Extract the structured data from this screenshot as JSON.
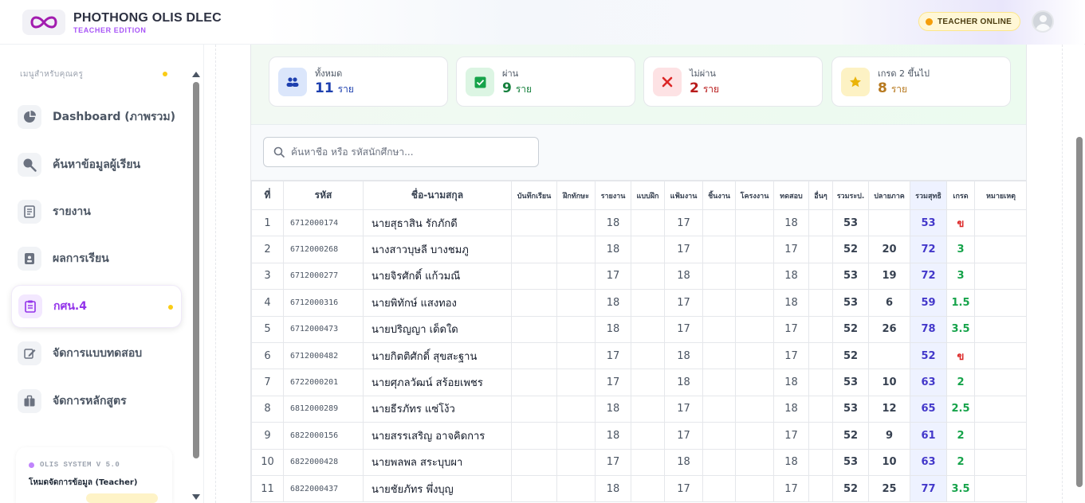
{
  "brand": {
    "title": "PHOTHONG OLIS DLEC",
    "subtitle": "TEACHER EDITION"
  },
  "header": {
    "status_badge": "TEACHER ONLINE"
  },
  "sidebar": {
    "heading": "เมนูสำหรับคุณครู",
    "items": [
      {
        "label": "Dashboard (ภาพรวม)",
        "icon": "pie-chart-icon"
      },
      {
        "label": "ค้นหาข้อมูลผู้เรียน",
        "icon": "search-icon"
      },
      {
        "label": "รายงาน",
        "icon": "report-icon"
      },
      {
        "label": "ผลการเรียน",
        "icon": "id-card-icon"
      },
      {
        "label": "กศน.4",
        "icon": "clipboard-icon",
        "active": true
      },
      {
        "label": "จัดการแบบทดสอบ",
        "icon": "edit-icon"
      },
      {
        "label": "จัดการหลักสูตร",
        "icon": "briefcase-icon"
      }
    ],
    "system": {
      "title": "OLIS SYSTEM V 5.0",
      "mode": "โหมดจัดการข้อมูล (Teacher)"
    }
  },
  "stats": [
    {
      "label": "ทั้งหมด",
      "value": "11",
      "unit": "ราย",
      "color": "#1e40af",
      "icon_bg": "#dbe6fb",
      "icon": "users-icon"
    },
    {
      "label": "ผ่าน",
      "value": "9",
      "unit": "ราย",
      "color": "#15803d",
      "icon_bg": "#dcf5e3",
      "icon": "check-square-icon"
    },
    {
      "label": "ไม่ผ่าน",
      "value": "2",
      "unit": "ราย",
      "color": "#b91c1c",
      "icon_bg": "#fde2e4",
      "icon": "x-icon"
    },
    {
      "label": "เกรด 2 ขึ้นไป",
      "value": "8",
      "unit": "ราย",
      "color": "#b7791f",
      "icon_bg": "#fdf2c4",
      "icon": "star-icon"
    }
  ],
  "search": {
    "placeholder": "ค้นหาชื่อ หรือ รหัสนักศึกษา..."
  },
  "table": {
    "columns": [
      "ที่",
      "รหัส",
      "ชื่อ-นามสกุล",
      "บันทึกเรียน",
      "ฝึกทักษะ",
      "รายงาน",
      "แบบฝึก",
      "แฟ้มงาน",
      "ชิ้นงาน",
      "โครงงาน",
      "ทดสอบ",
      "อื่นๆ",
      "รวมระป.",
      "ปลายภาค",
      "รวมสุทธิ",
      "เกรด",
      "หมายเหตุ"
    ],
    "rows": [
      [
        "1",
        "6712000174",
        "นายสุธาสิน รักภักดี",
        "",
        "",
        "18",
        "",
        "17",
        "",
        "",
        "18",
        "",
        "53",
        "",
        "53",
        "ข",
        ""
      ],
      [
        "2",
        "6712000268",
        "นางสาวบุษลี บางชมภู",
        "",
        "",
        "18",
        "",
        "17",
        "",
        "",
        "17",
        "",
        "52",
        "20",
        "72",
        "3",
        ""
      ],
      [
        "3",
        "6712000277",
        "นายจิรศักดิ์ แก้วมณี",
        "",
        "",
        "17",
        "",
        "18",
        "",
        "",
        "18",
        "",
        "53",
        "19",
        "72",
        "3",
        ""
      ],
      [
        "4",
        "6712000316",
        "นายพิทักษ์ แสงทอง",
        "",
        "",
        "18",
        "",
        "17",
        "",
        "",
        "18",
        "",
        "53",
        "6",
        "59",
        "1.5",
        ""
      ],
      [
        "5",
        "6712000473",
        "นายปริญญา เด็ดใด",
        "",
        "",
        "18",
        "",
        "17",
        "",
        "",
        "17",
        "",
        "52",
        "26",
        "78",
        "3.5",
        ""
      ],
      [
        "6",
        "6712000482",
        "นายกิตติศักดิ์ สุขสะฐาน",
        "",
        "",
        "17",
        "",
        "18",
        "",
        "",
        "17",
        "",
        "52",
        "",
        "52",
        "ข",
        ""
      ],
      [
        "7",
        "6722000201",
        "นายศุภลวัฒน์ สร้อยเพชร",
        "",
        "",
        "17",
        "",
        "18",
        "",
        "",
        "18",
        "",
        "53",
        "10",
        "63",
        "2",
        ""
      ],
      [
        "8",
        "6812000289",
        "นายธีรภัทร แซ่โง้ว",
        "",
        "",
        "18",
        "",
        "17",
        "",
        "",
        "18",
        "",
        "53",
        "12",
        "65",
        "2.5",
        ""
      ],
      [
        "9",
        "6822000156",
        "นายสรรเสริญ อาจคิดการ",
        "",
        "",
        "18",
        "",
        "17",
        "",
        "",
        "17",
        "",
        "52",
        "9",
        "61",
        "2",
        ""
      ],
      [
        "10",
        "6822000428",
        "นายพลพล สระบุบผา",
        "",
        "",
        "17",
        "",
        "18",
        "",
        "",
        "18",
        "",
        "53",
        "10",
        "63",
        "2",
        ""
      ],
      [
        "11",
        "6822000437",
        "นายชัยภัทร พึ่งบุญ",
        "",
        "",
        "18",
        "",
        "17",
        "",
        "",
        "17",
        "",
        "52",
        "25",
        "77",
        "3.5",
        ""
      ]
    ]
  },
  "colors": {
    "accent": "#9333ea",
    "pass": "#16a34a",
    "fail": "#dc2626",
    "total": "#4338ca"
  }
}
